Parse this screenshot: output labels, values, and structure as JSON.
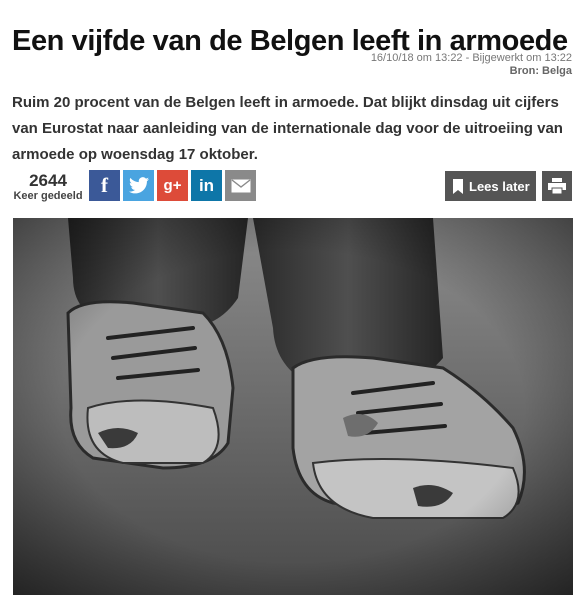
{
  "article": {
    "title": "Een vijfde van de Belgen leeft in armoede",
    "date_line": "16/10/18 om 13:22 - Bijgewerkt om 13:22",
    "source": "Bron: Belga",
    "lead": "Ruim 20 procent van de Belgen leeft in armoede. Dat blijkt dinsdag uit cijfers van Eurostat naar aanleiding van de internationale dag voor de uitroeiing van armoede op woensdag 17 oktober."
  },
  "share": {
    "count": "2644",
    "count_label": "Keer gedeeld",
    "buttons": [
      {
        "icon": "facebook-icon",
        "color": "#3b5998"
      },
      {
        "icon": "twitter-icon",
        "color": "#4aa4e0"
      },
      {
        "icon": "google-plus-icon",
        "color": "#dd4b39"
      },
      {
        "icon": "linkedin-icon",
        "color": "#0e76a8"
      },
      {
        "icon": "mail-icon",
        "color": "#8a8a8a"
      }
    ]
  },
  "toolbar": {
    "read_later_label": "Lees later",
    "read_later_icon": "bookmark-icon",
    "print_icon": "print-icon"
  },
  "image": {
    "subject": "worn-out-shoes-photo"
  }
}
